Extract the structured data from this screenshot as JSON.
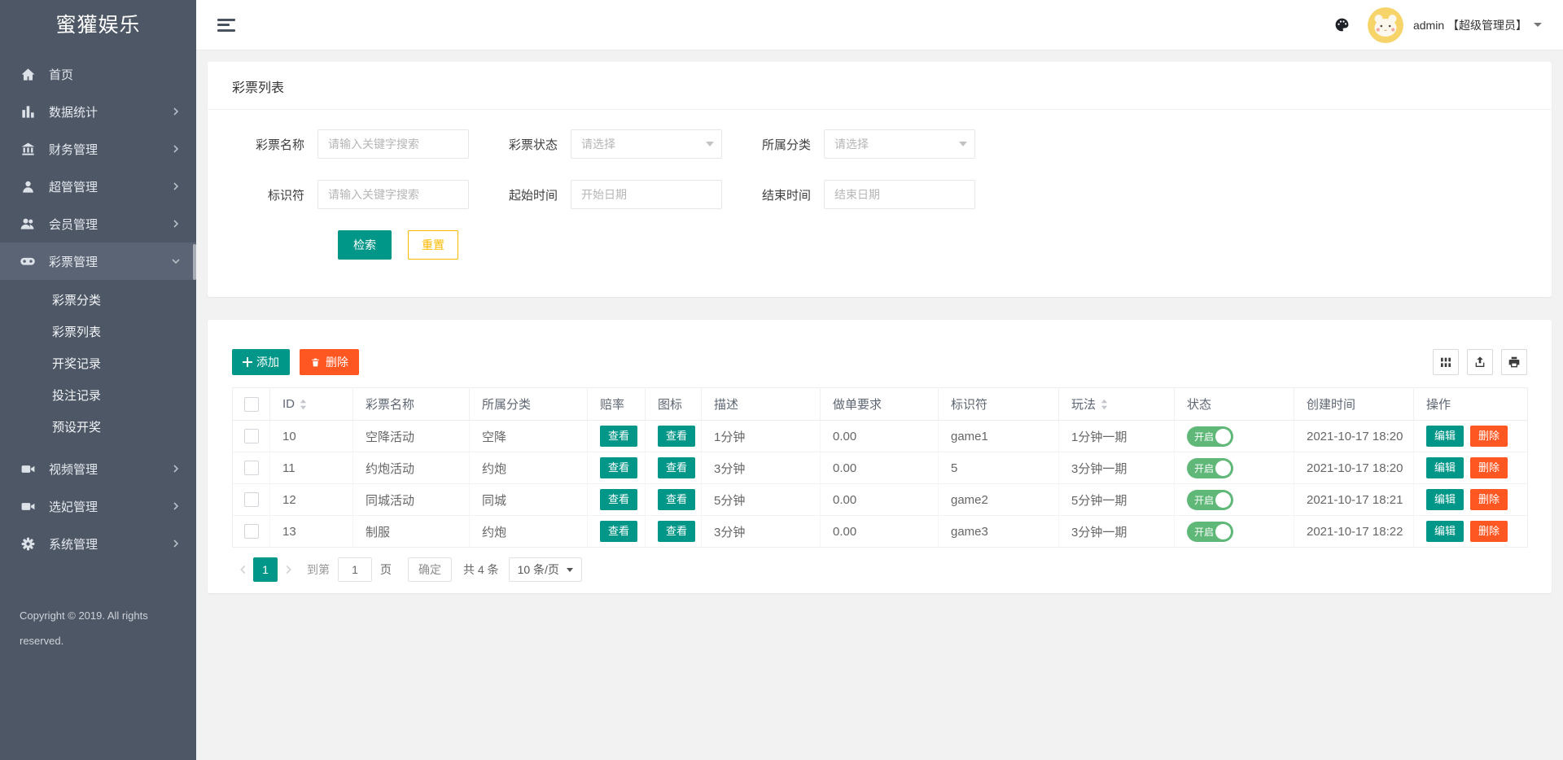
{
  "app": {
    "logo": "蜜獾娱乐",
    "user": "admin 【超级管理员】"
  },
  "sidebar": {
    "items": [
      {
        "label": "首页",
        "icon": "home-icon"
      },
      {
        "label": "数据统计",
        "icon": "chart-icon"
      },
      {
        "label": "财务管理",
        "icon": "bank-icon"
      },
      {
        "label": "超管管理",
        "icon": "user-icon"
      },
      {
        "label": "会员管理",
        "icon": "users-icon"
      },
      {
        "label": "彩票管理",
        "icon": "gamepad-icon"
      },
      {
        "label": "视频管理",
        "icon": "video-camera-icon"
      },
      {
        "label": "选妃管理",
        "icon": "video-camera-icon"
      },
      {
        "label": "系统管理",
        "icon": "gear-icon"
      }
    ],
    "submenu": [
      {
        "label": "彩票分类"
      },
      {
        "label": "彩票列表"
      },
      {
        "label": "开奖记录"
      },
      {
        "label": "投注记录"
      },
      {
        "label": "预设开奖"
      }
    ],
    "copyright": "Copyright © 2019. All rights reserved."
  },
  "page": {
    "title": "彩票列表"
  },
  "search": {
    "name_label": "彩票名称",
    "name_placeholder": "请输入关键字搜索",
    "status_label": "彩票状态",
    "status_placeholder": "请选择",
    "category_label": "所属分类",
    "category_placeholder": "请选择",
    "ident_label": "标识符",
    "ident_placeholder": "请输入关键字搜索",
    "start_label": "起始时间",
    "start_placeholder": "开始日期",
    "end_label": "结束时间",
    "end_placeholder": "结束日期",
    "submit": "检索",
    "reset": "重置"
  },
  "toolbar": {
    "add": "添加",
    "delete": "删除"
  },
  "table": {
    "columns": [
      "ID",
      "彩票名称",
      "所属分类",
      "赔率",
      "图标",
      "描述",
      "做单要求",
      "标识符",
      "玩法",
      "状态",
      "创建时间",
      "操作"
    ],
    "labels": {
      "view": "查看",
      "edit": "编辑",
      "delete": "删除",
      "status_on": "开启"
    },
    "rows": [
      {
        "id": "10",
        "name": "空降活动",
        "category": "空降",
        "desc": "1分钟",
        "requirement": "0.00",
        "identifier": "game1",
        "play": "1分钟一期",
        "created": "2021-10-17 18:20"
      },
      {
        "id": "11",
        "name": "约炮活动",
        "category": "约炮",
        "desc": "3分钟",
        "requirement": "0.00",
        "identifier": "5",
        "play": "3分钟一期",
        "created": "2021-10-17 18:20"
      },
      {
        "id": "12",
        "name": "同城活动",
        "category": "同城",
        "desc": "5分钟",
        "requirement": "0.00",
        "identifier": "game2",
        "play": "5分钟一期",
        "created": "2021-10-17 18:21"
      },
      {
        "id": "13",
        "name": "制服",
        "category": "约炮",
        "desc": "3分钟",
        "requirement": "0.00",
        "identifier": "game3",
        "play": "3分钟一期",
        "created": "2021-10-17 18:22"
      }
    ]
  },
  "pagination": {
    "page": "1",
    "goto_label": "到第",
    "goto_value": "1",
    "page_unit": "页",
    "confirm": "确定",
    "total": "共 4 条",
    "per_page": "10 条/页"
  },
  "icons": {
    "menu_toggle": "hamburger-icon",
    "theme": "palette-icon",
    "toolbar": [
      "columns-icon",
      "export-icon",
      "print-icon"
    ],
    "row_actions": [
      "edit",
      "delete"
    ],
    "sort": "sort-icon"
  },
  "colors": {
    "accent": "#009688",
    "danger": "#FF5722",
    "warning": "#FFB800",
    "toggle_on": "#5FB878",
    "sidebar_bg": "#4e5765"
  }
}
